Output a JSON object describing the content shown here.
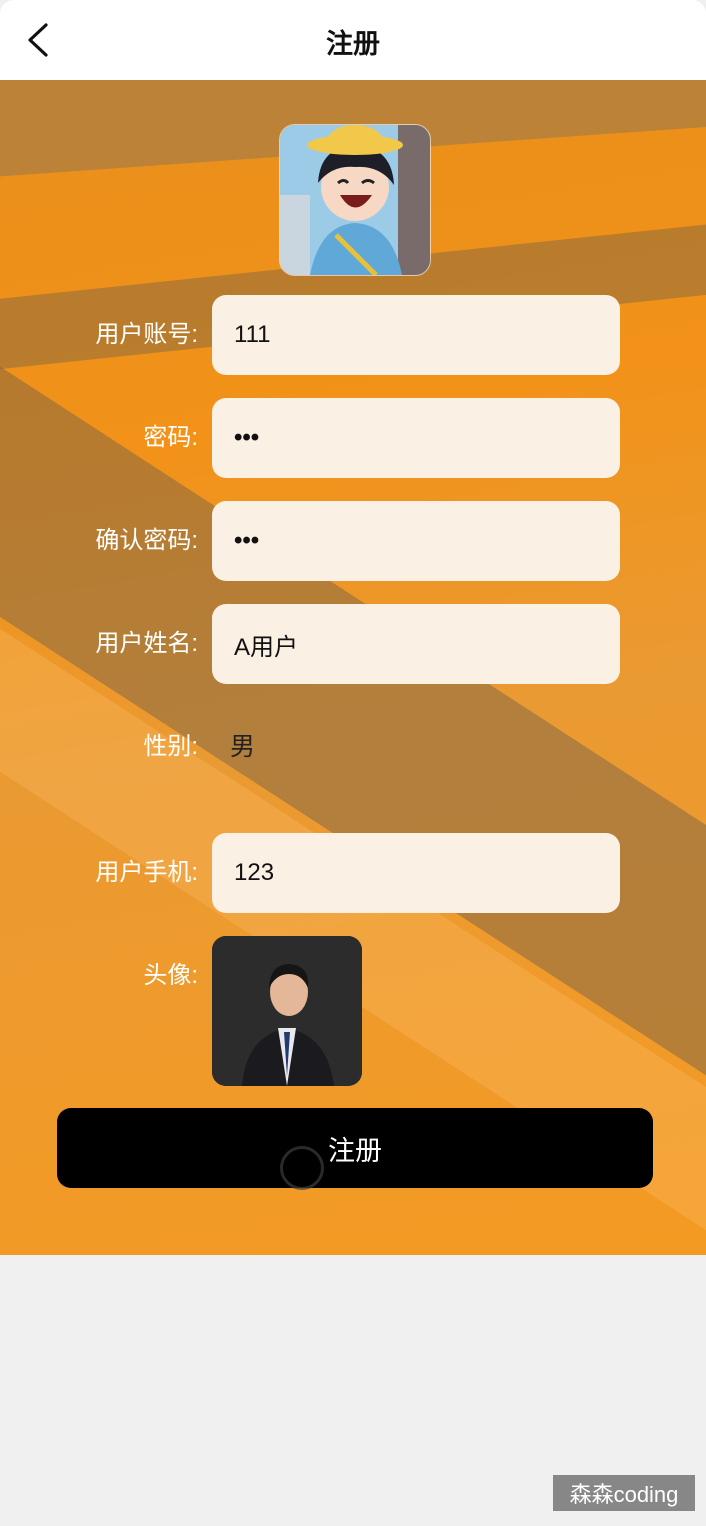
{
  "header": {
    "title": "注册",
    "back_icon": "chevron-left-icon"
  },
  "form": {
    "account": {
      "label": "用户账号:",
      "value": "111"
    },
    "password": {
      "label": "密码:",
      "value": "•••"
    },
    "confirm_password": {
      "label": "确认密码:",
      "value": "•••"
    },
    "name": {
      "label": "用户姓名:",
      "value": "A用户"
    },
    "gender": {
      "label": "性别:",
      "value": "男"
    },
    "phone": {
      "label": "用户手机:",
      "value": "123"
    },
    "avatar": {
      "label": "头像:"
    }
  },
  "submit_label": "注册",
  "watermark": "森森coding",
  "colors": {
    "accent_orange": "#f29218",
    "field_bg": "#fbf0e4",
    "button_bg": "#000000"
  }
}
